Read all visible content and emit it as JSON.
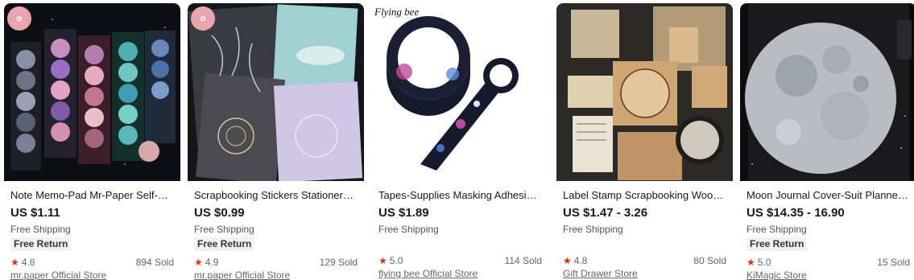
{
  "products": [
    {
      "title": "Note Memo-Pad Mr-Paper Self-Sticky Notes...",
      "price": "US $1.11",
      "shipping": "Free Shipping",
      "free_return": "Free Return",
      "rating": "4.8",
      "sold": "894 Sold",
      "store": "mr.paper Official Store",
      "badge": "mr.paper"
    },
    {
      "title": "Scrapbooking Stickers Stationery ...",
      "price": "US $0.99",
      "shipping": "Free Shipping",
      "free_return": "Free Return",
      "rating": "4.9",
      "sold": "129 Sold",
      "store": "mr.paper Official Store",
      "badge": "mr.paper"
    },
    {
      "title": "Tapes-Supplies Masking Adhesive-...",
      "price": "US $1.89",
      "shipping": "Free Shipping",
      "rating": "5.0",
      "sold": "114 Sold",
      "store": "flying bee Official Store",
      "image_caption": "Flying bee"
    },
    {
      "title": "Label Stamp Scrapbooking Wooden...",
      "price": "US $1.47 - 3.26",
      "shipping": "Free Shipping",
      "rating": "4.8",
      "sold": "80 Sold",
      "store": "Gift Drawer Store"
    },
    {
      "title": "Moon Journal Cover-Suit Planner-S...",
      "price": "US $14.35 - 16.90",
      "shipping": "Free Shipping",
      "free_return": "Free Return",
      "rating": "5.0",
      "sold": "15 Sold",
      "store": "KiMagic Store"
    }
  ],
  "icons": {
    "rating": "star-icon"
  },
  "colors": {
    "star": "#e62e04",
    "price": "#191919"
  }
}
